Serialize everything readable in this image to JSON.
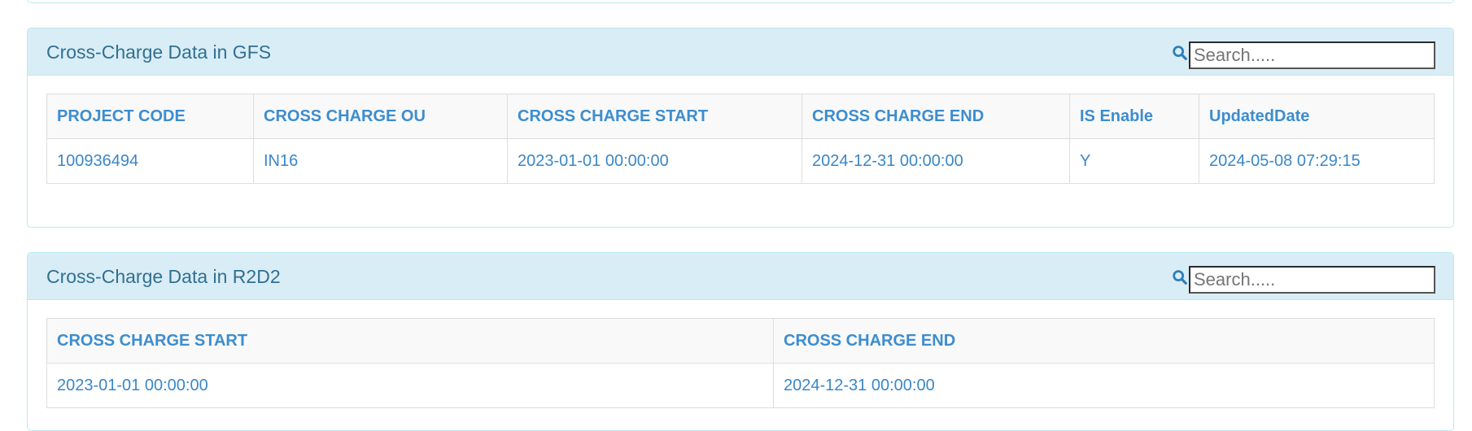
{
  "search_placeholder": "Search.....",
  "gfs": {
    "title": "Cross-Charge Data in GFS",
    "columns": [
      "PROJECT CODE",
      "CROSS CHARGE OU",
      "CROSS CHARGE START",
      "CROSS CHARGE END",
      "IS Enable",
      "UpdatedDate"
    ],
    "rows": [
      [
        "100936494",
        "IN16",
        "2023-01-01 00:00:00",
        "2024-12-31 00:00:00",
        "Y",
        "2024-05-08 07:29:15"
      ]
    ]
  },
  "r2d2": {
    "title": "Cross-Charge Data in R2D2",
    "columns": [
      "CROSS CHARGE START",
      "CROSS CHARGE END"
    ],
    "rows": [
      [
        "2023-01-01 00:00:00",
        "2024-12-31 00:00:00"
      ]
    ]
  },
  "colors": {
    "heading_bg": "#d9edf7",
    "border": "#bce8f1",
    "title_text": "#31708f",
    "link_text": "#3a87c8"
  }
}
